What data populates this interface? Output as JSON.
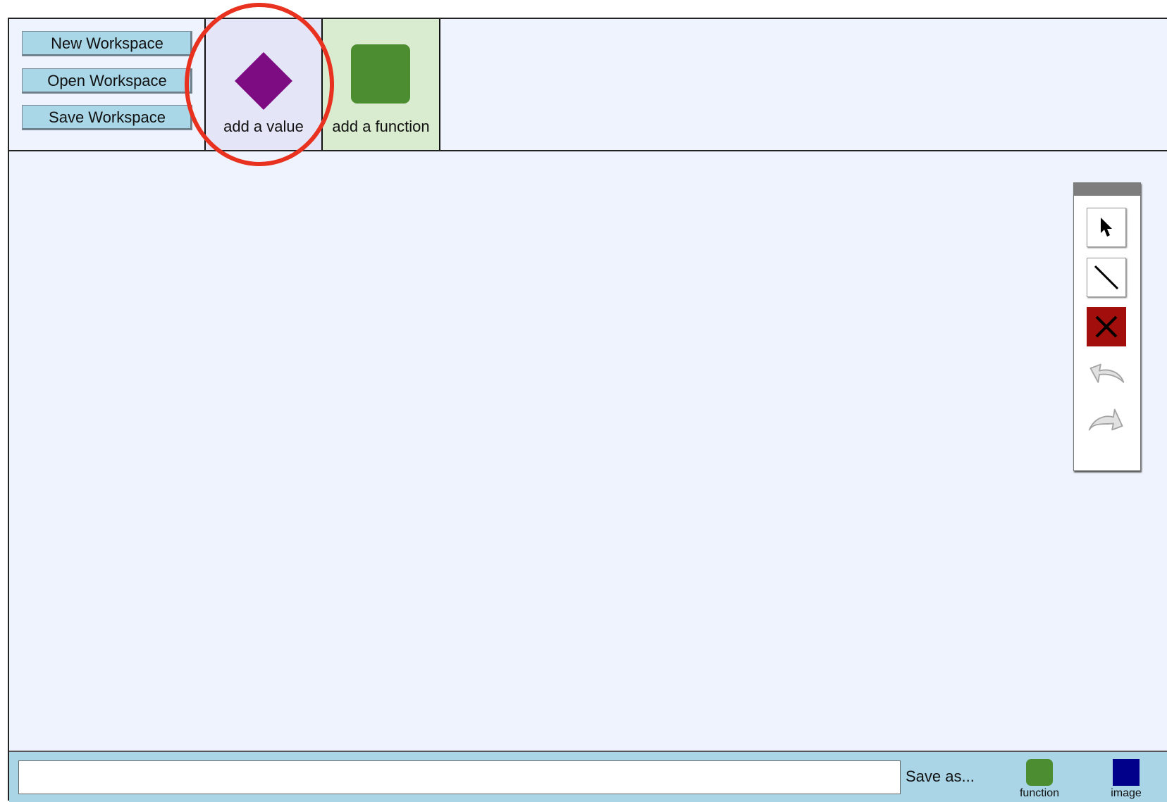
{
  "workspace_buttons": {
    "new": "New Workspace",
    "open": "Open Workspace",
    "save": "Save Workspace"
  },
  "add_tools": {
    "value": {
      "label": "add a value",
      "icon": "diamond-icon",
      "color": "#7d0c82"
    },
    "function": {
      "label": "add a function",
      "icon": "square-icon",
      "color": "#4d8d31"
    }
  },
  "tool_palette": {
    "tools": [
      "select-arrow-icon",
      "line-icon",
      "delete-icon",
      "undo-icon",
      "redo-icon"
    ],
    "delete_color": "#a10e0b"
  },
  "bottom_bar": {
    "input_value": "",
    "save_as_label": "Save as...",
    "legend": [
      {
        "label": "function",
        "color": "#4d8d31"
      },
      {
        "label": "image",
        "color": "#00008b"
      }
    ]
  },
  "colors": {
    "canvas": "#eff3fd",
    "button_bg": "#aad7e7",
    "highlight_ring": "#e8311f"
  }
}
